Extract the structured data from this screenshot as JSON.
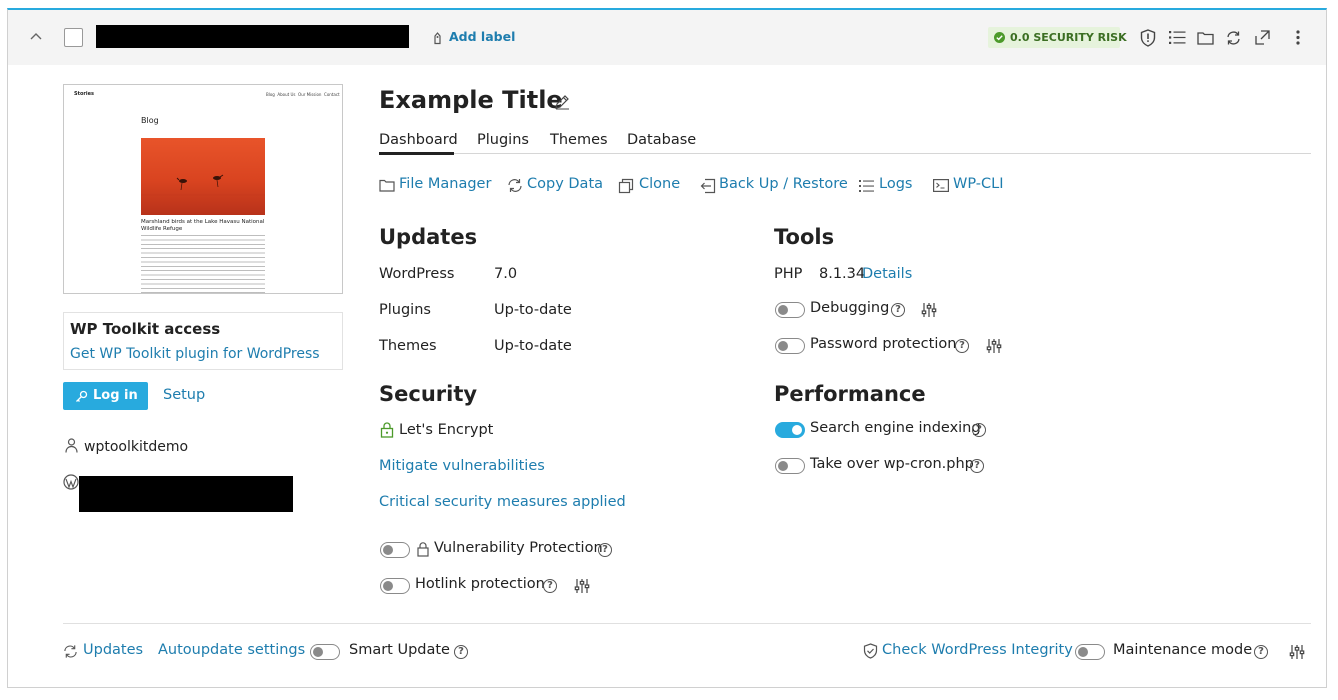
{
  "header": {
    "add_label": "Add label",
    "security_badge": "0.0 SECURITY RISK"
  },
  "site": {
    "title": "Example Title",
    "preview": {
      "brand": "Stories",
      "nav": [
        "Blog",
        "About Us",
        "Our Mission",
        "Contact"
      ],
      "heading": "Blog",
      "caption": "Marshland birds at the Lake Havasu National Wildlife Refuge"
    }
  },
  "tabs": [
    "Dashboard",
    "Plugins",
    "Themes",
    "Database"
  ],
  "actions": [
    {
      "label": "File Manager",
      "icon": "folder-icon"
    },
    {
      "label": "Copy Data",
      "icon": "copy-data-icon"
    },
    {
      "label": "Clone",
      "icon": "clone-icon"
    },
    {
      "label": "Back Up / Restore",
      "icon": "backup-icon"
    },
    {
      "label": "Logs",
      "icon": "logs-icon"
    },
    {
      "label": "WP-CLI",
      "icon": "terminal-icon"
    }
  ],
  "left": {
    "toolkit_title": "WP Toolkit access",
    "toolkit_link": "Get WP Toolkit plugin for WordPress",
    "login_label": "Log in",
    "setup_label": "Setup",
    "username": "wptoolkitdemo"
  },
  "updates": {
    "title": "Updates",
    "rows": [
      {
        "label": "WordPress",
        "value": "7.0"
      },
      {
        "label": "Plugins",
        "value": "Up-to-date"
      },
      {
        "label": "Themes",
        "value": "Up-to-date"
      }
    ]
  },
  "security": {
    "title": "Security",
    "ssl": "Let's Encrypt",
    "mitigate": "Mitigate vulnerabilities",
    "critical": "Critical security measures applied",
    "vuln_protection": "Vulnerability Protection",
    "hotlink": "Hotlink protection"
  },
  "tools": {
    "title": "Tools",
    "php_label": "PHP",
    "php_version": "8.1.34",
    "details": "Details",
    "debugging": "Debugging",
    "password": "Password protection"
  },
  "performance": {
    "title": "Performance",
    "indexing": "Search engine indexing",
    "indexing_on": true,
    "wpcron": "Take over wp-cron.php"
  },
  "footer": {
    "updates": "Updates",
    "autoupdate": "Autoupdate settings",
    "smart_update": "Smart Update",
    "integrity": "Check WordPress Integrity",
    "maintenance": "Maintenance mode"
  },
  "colors": {
    "accent": "#28aade",
    "link": "#1e7dae",
    "badge_bg": "#e6f3dc",
    "badge_text": "#3b6e22",
    "ssl_green": "#4c9a2a"
  }
}
